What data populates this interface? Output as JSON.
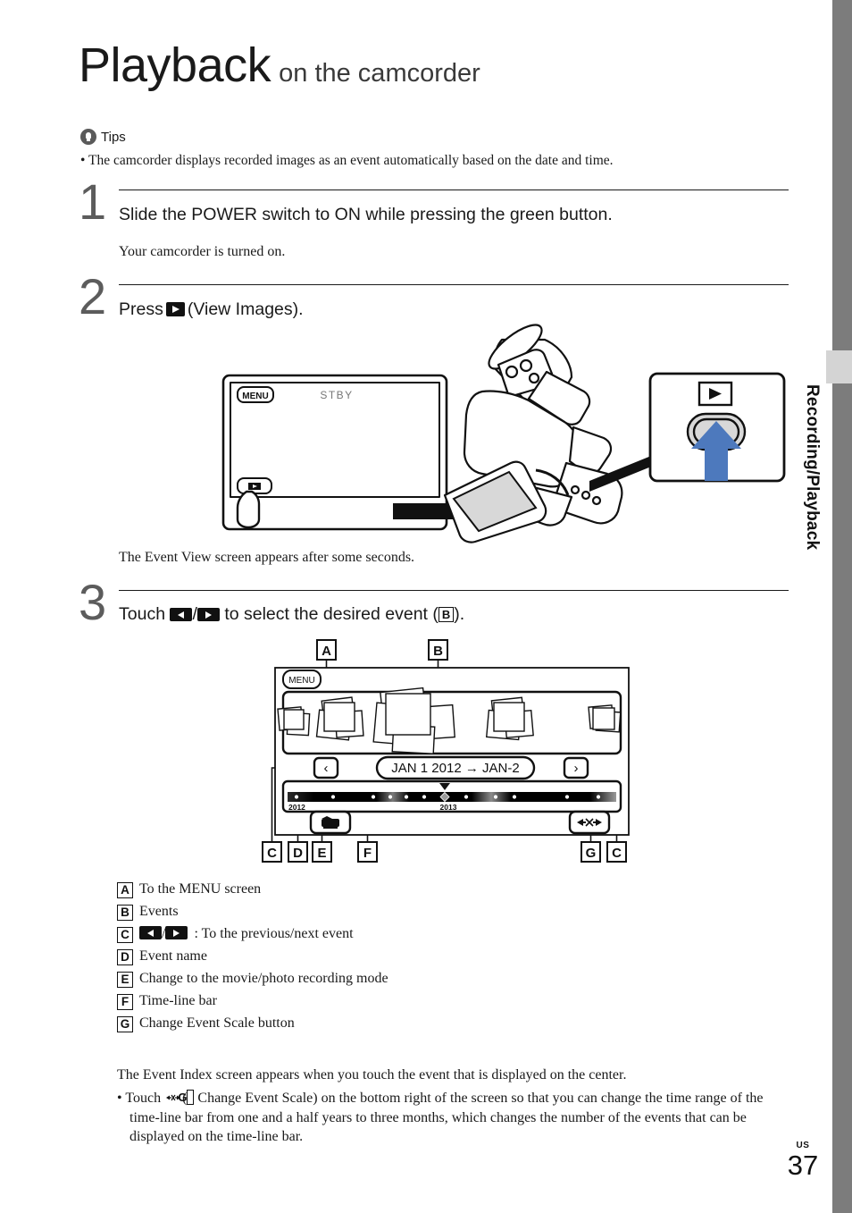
{
  "page": {
    "title_main": "Playback",
    "title_sub": "on the camcorder",
    "country_code": "US",
    "number": "37",
    "side_tab_label": "Recording/Playback"
  },
  "tips": {
    "icon": "lightbulb-icon",
    "label": "Tips",
    "bullet": "• The camcorder displays recorded images as an event automatically based on the date and time."
  },
  "steps": [
    {
      "number": "1",
      "title": "Slide the POWER switch to ON while pressing the green button.",
      "description": "Your camcorder is turned on."
    },
    {
      "number": "2",
      "title_before": "Press",
      "title_after": "(View Images).",
      "description": "The Event View screen appears after some seconds."
    },
    {
      "number": "3",
      "title_before": "Touch",
      "title_mid": "/",
      "title_after": "to select the desired event (",
      "title_tag": "B",
      "title_end": ")."
    }
  ],
  "camcorder_figure": {
    "lcd": {
      "menu_button": "MENU",
      "status_text": "STBY",
      "view_images_icon": "play-icon",
      "finger_icon": "finger-touch-icon"
    },
    "callout": {
      "play_icon_label": "play-icon",
      "button_icon": "view-images-button",
      "arrow_color": "#4d79bd",
      "arrow_icon": "up-arrow-icon"
    }
  },
  "eventview_figure": {
    "callouts": {
      "a": "A",
      "b": "B",
      "c_left": "C",
      "d": "D",
      "e": "E",
      "f": "F",
      "g": "G",
      "c_right": "C"
    },
    "menu_button": "MENU",
    "prev_button": "‹",
    "next_button": "›",
    "event_name": "JAN 1 2012 → JAN-2",
    "timeline": {
      "start_year": "2012",
      "end_year": "2013",
      "marker": "▼"
    },
    "mode_button_icon": "movie-photo-mode-icon",
    "scale_button_icon": "change-event-scale-icon"
  },
  "legend": [
    {
      "tag": "A",
      "text": "To the MENU screen",
      "icons": false
    },
    {
      "tag": "B",
      "text": "Events",
      "icons": false
    },
    {
      "tag": "C",
      "text": ": To the previous/next event",
      "icons": true
    },
    {
      "tag": "D",
      "text": "Event name",
      "icons": false
    },
    {
      "tag": "E",
      "text": "Change to the movie/photo recording mode",
      "icons": false
    },
    {
      "tag": "F",
      "text": "Time-line bar",
      "icons": false
    },
    {
      "tag": "G",
      "text": "Change Event Scale button",
      "icons": false
    }
  ],
  "closing": {
    "paragraph": "The Event Index screen appears when you touch the event that is displayed on the center.",
    "bullet_before": "• Touch",
    "bullet_tag": "G",
    "bullet_after": "Change Event Scale) on the bottom right of the screen so that you can change the time range of the time-line bar from one and a half years to three months, which changes the number of the events that can be displayed on the time-line bar.",
    "bullet_open_paren": "("
  },
  "colors": {
    "arrow_blue": "#4d79bd",
    "edge_gray": "#7c7c7c",
    "tab_gray": "#d4d4d4",
    "step_number_gray": "#5c5c5c"
  }
}
